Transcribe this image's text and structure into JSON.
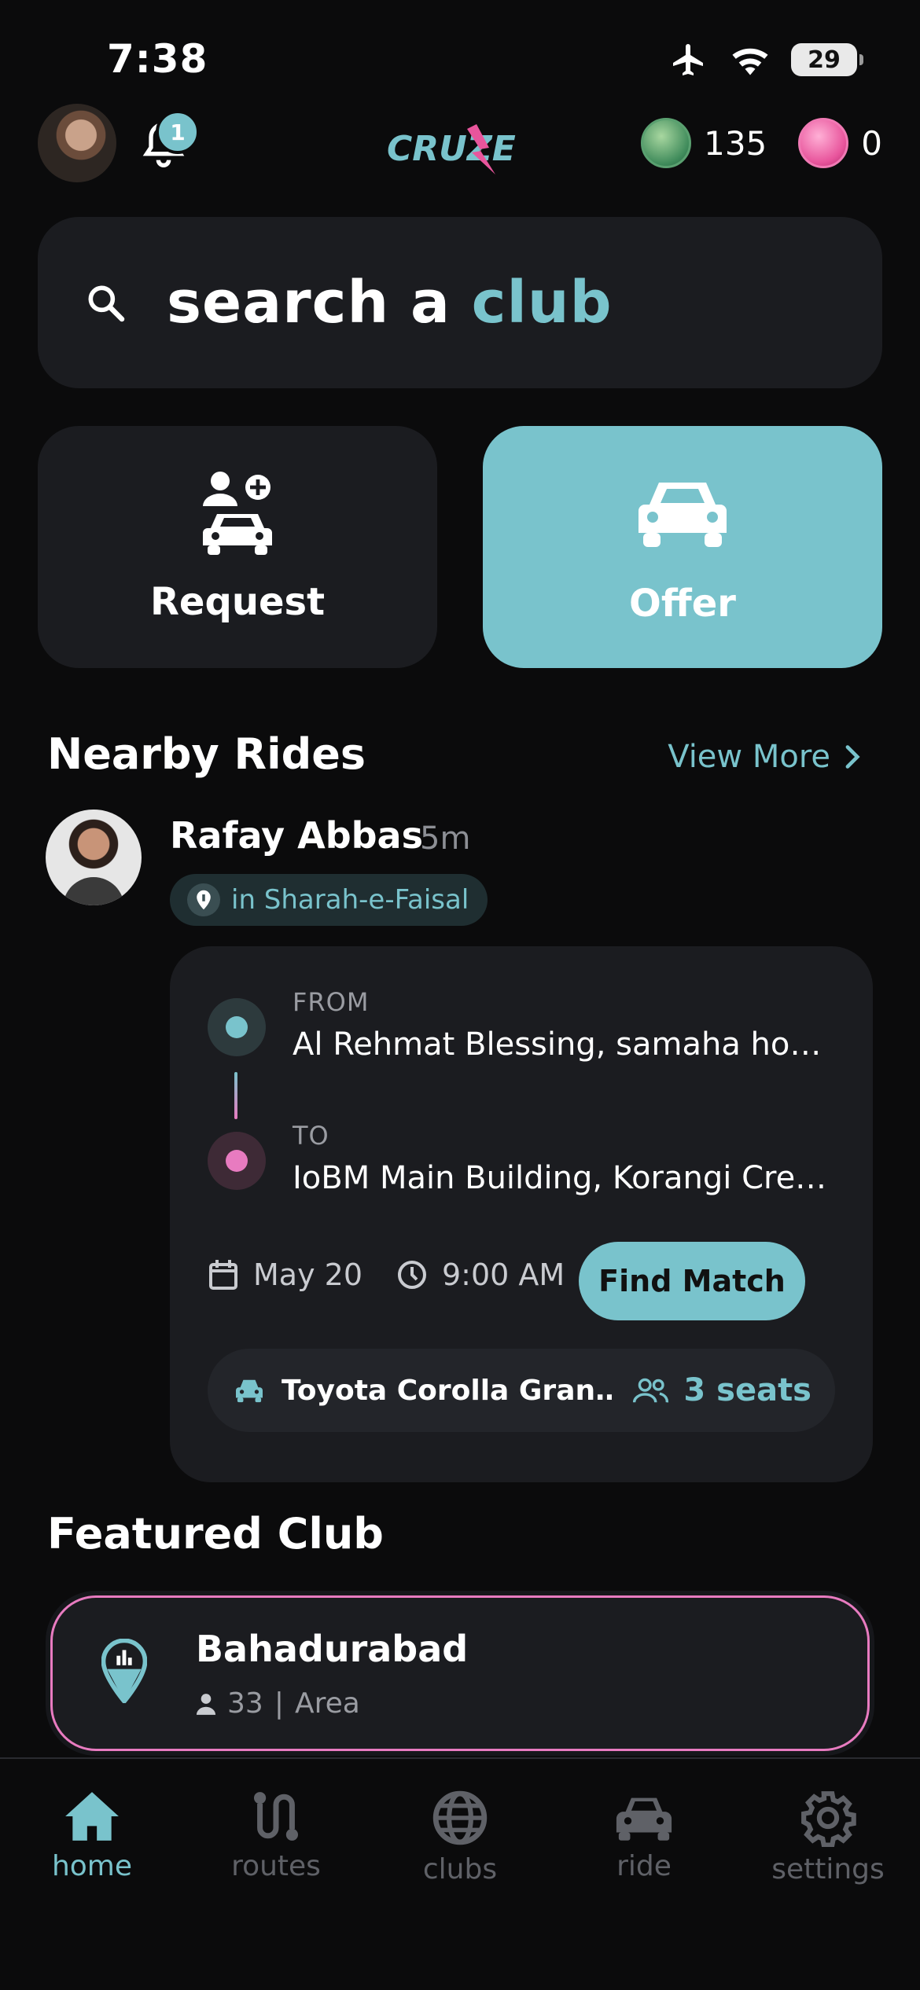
{
  "status_bar": {
    "time": "7:38",
    "battery": "29"
  },
  "header": {
    "notification_count": "1",
    "logo_text": "CRUZE",
    "green_coin_count": "135",
    "pink_coin_count": "0"
  },
  "search": {
    "prefix": "search a ",
    "accent_word": "club"
  },
  "actions": {
    "request_label": "Request",
    "offer_label": "Offer"
  },
  "nearby": {
    "title": "Nearby Rides",
    "view_more": "View More",
    "ride": {
      "driver_name": "Rafay Abbas",
      "posted_ago": "5m",
      "location": "in Sharah-e-Faisal",
      "from_label": "FROM",
      "from_address": "Al Rehmat Blessing, samaha ho…",
      "to_label": "TO",
      "to_address": "IoBM Main Building, Korangi Cre…",
      "date": "May 20",
      "time": "9:00 AM",
      "find_match": "Find Match",
      "vehicle": "Toyota Corolla Gran…",
      "seats": "3 seats"
    }
  },
  "featured": {
    "title": "Featured Club",
    "club_name": "Bahadurabad",
    "members": "33",
    "separator": "|",
    "type": "Area"
  },
  "nav": {
    "items": [
      {
        "label": "home",
        "icon": "home-icon",
        "active": true
      },
      {
        "label": "routes",
        "icon": "routes-icon",
        "active": false
      },
      {
        "label": "clubs",
        "icon": "globe-icon",
        "active": false
      },
      {
        "label": "ride",
        "icon": "car-icon",
        "active": false
      },
      {
        "label": "settings",
        "icon": "gear-icon",
        "active": false
      }
    ]
  },
  "colors": {
    "accent": "#79c3cc",
    "pink": "#e87bc0",
    "card": "#1b1c20",
    "background": "#0b0b0c"
  }
}
